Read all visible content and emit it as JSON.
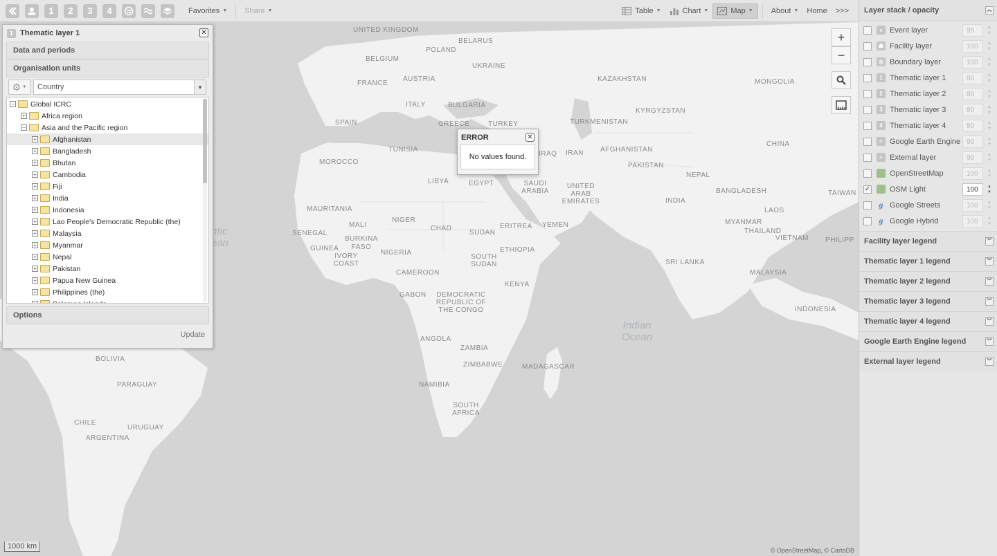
{
  "toolbar": {
    "layer_buttons": [
      "1",
      "2",
      "3",
      "4"
    ],
    "favorites": "Favorites",
    "share": "Share",
    "table": "Table",
    "chart": "Chart",
    "map": "Map",
    "about": "About",
    "home": "Home",
    "expand": ">>>"
  },
  "panel": {
    "badge": "1",
    "title": "Thematic layer 1",
    "close": "✕",
    "sections": {
      "data_periods": "Data and periods",
      "org_units": "Organisation units",
      "options": "Options"
    },
    "level_select": "Country",
    "tree": {
      "root": "Global ICRC",
      "regions": [
        {
          "label": "Africa region",
          "expanded": false
        },
        {
          "label": "Asia and the Pacific region",
          "expanded": true
        }
      ],
      "countries": [
        "Afghanistan",
        "Bangladesh",
        "Bhutan",
        "Cambodia",
        "Fiji",
        "India",
        "Indonesia",
        "Lao People's Democratic Republic (the)",
        "Malaysia",
        "Myanmar",
        "Nepal",
        "Pakistan",
        "Papua New Guinea",
        "Philippines (the)",
        "Solomon Islands"
      ],
      "selected": "Afghanistan"
    },
    "update": "Update"
  },
  "error_dialog": {
    "title": "ERROR",
    "message": "No values found.",
    "close": "✕"
  },
  "map": {
    "zoom_in": "+",
    "zoom_out": "−",
    "scale": "1000 km",
    "attribution": "© OpenStreetMap, © CartoDB",
    "oceans": [
      {
        "text": "Indian\nOcean"
      },
      {
        "text": "ntic\nean"
      }
    ],
    "countries": [
      "UNITED KINGDOM",
      "BELARUS",
      "POLAND",
      "BELGIUM",
      "UKRAINE",
      "KAZAKHSTAN",
      "FRANCE",
      "AUSTRIA",
      "MONGOLIA",
      "ITALY",
      "BULGARIA",
      "KYRGYZSTAN",
      "SPAIN",
      "GREECE",
      "TURKEY",
      "TURKMENISTAN",
      "TUNISIA",
      "AFGHANISTAN",
      "CHINA",
      "MOROCCO",
      "IRAQ",
      "IRAN",
      "PAKISTAN",
      "LIBYA",
      "EGYPT",
      "SAUDI ARABIA",
      "NEPAL",
      "UNITED ARAB EMIRATES",
      "BANGLADESH",
      "TAIWAN",
      "INDIA",
      "MAURITANIA",
      "MALI",
      "NIGER",
      "LAOS",
      "MYANMAR",
      "THAILAND",
      "CHAD",
      "SUDAN",
      "ERITREA",
      "YEMEN",
      "VIETNAM",
      "PHILIPP",
      "SENEGAL",
      "GUINEA",
      "BURKINA FASO",
      "NIGERIA",
      "ETHIOPIA",
      "IVORY COAST",
      "SOUTH SUDAN",
      "SRI LANKA",
      "CAMEROON",
      "MALAYSIA",
      "KENYA",
      "GABON",
      "DEMOCRATIC REPUBLIC OF THE CONGO",
      "INDONESIA",
      "BOLIVIA",
      "ANGOLA",
      "ZAMBIA",
      "ZIMBABWE",
      "MADAGASCAR",
      "PARAGUAY",
      "NAMIBIA",
      "CHILE",
      "URUGUAY",
      "SOUTH AFRICA",
      "ARGENTINA"
    ]
  },
  "right_panel": {
    "stack_title": "Layer stack / opacity",
    "layers": [
      {
        "name": "Event layer",
        "opacity": "95",
        "checked": false,
        "icon": "event"
      },
      {
        "name": "Facility layer",
        "opacity": "100",
        "checked": false,
        "icon": "facility"
      },
      {
        "name": "Boundary layer",
        "opacity": "100",
        "checked": false,
        "icon": "boundary"
      },
      {
        "name": "Thematic layer 1",
        "opacity": "80",
        "checked": false,
        "icon": "1"
      },
      {
        "name": "Thematic layer 2",
        "opacity": "80",
        "checked": false,
        "icon": "2"
      },
      {
        "name": "Thematic layer 3",
        "opacity": "80",
        "checked": false,
        "icon": "3"
      },
      {
        "name": "Thematic layer 4",
        "opacity": "80",
        "checked": false,
        "icon": "4"
      },
      {
        "name": "Google Earth Engine",
        "opacity": "90",
        "checked": false,
        "icon": "gee"
      },
      {
        "name": "External layer",
        "opacity": "90",
        "checked": false,
        "icon": "external"
      },
      {
        "name": "OpenStreetMap",
        "opacity": "100",
        "checked": false,
        "icon": "osm"
      },
      {
        "name": "OSM Light",
        "opacity": "100",
        "checked": true,
        "icon": "osm"
      },
      {
        "name": "Google Streets",
        "opacity": "100",
        "checked": false,
        "icon": "google"
      },
      {
        "name": "Google Hybrid",
        "opacity": "100",
        "checked": false,
        "icon": "google"
      }
    ],
    "legends": [
      "Facility layer legend",
      "Thematic layer 1 legend",
      "Thematic layer 2 legend",
      "Thematic layer 3 legend",
      "Thematic layer 4 legend",
      "Google Earth Engine legend",
      "External layer legend"
    ]
  }
}
